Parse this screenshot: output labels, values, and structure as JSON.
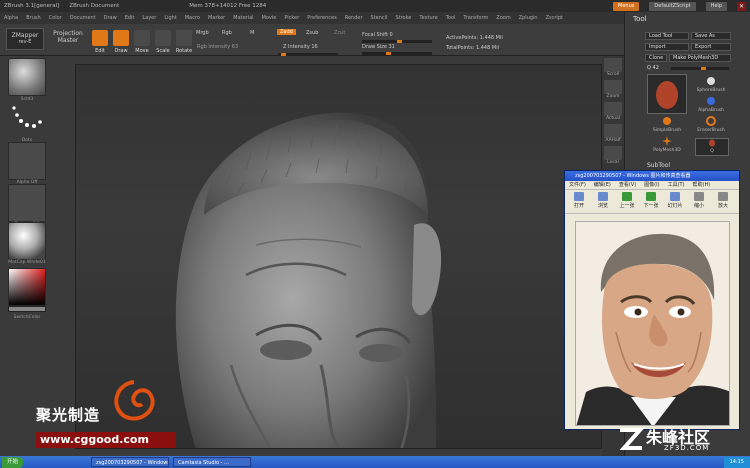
{
  "titlebar": {
    "app": "ZBrush 3.1[general]",
    "doc": "ZBrush Document",
    "mem": "Mem 378+14012 Free 1284",
    "menus_btn": "Menus",
    "script_btn": "DefaultZScript",
    "help_btn": "Help"
  },
  "menubar": {
    "items": [
      "Alpha",
      "Brush",
      "Color",
      "Document",
      "Draw",
      "Edit",
      "Layer",
      "Light",
      "Macro",
      "Marker",
      "Material",
      "Movie",
      "Picker",
      "Preferences",
      "Render",
      "Stencil",
      "Stroke",
      "Texture",
      "Tool",
      "Transform",
      "Zoom",
      "Zplugin",
      "Zscript"
    ]
  },
  "toolbar": {
    "zmapper": "ZMapper",
    "zmapper_sub": "rev-E",
    "projection": "Projection",
    "projection_sub": "Master",
    "edit": "Edit",
    "draw": "Draw",
    "move": "Move",
    "scale": "Scale",
    "rotate": "Rotate",
    "mrgb": "Mrgb",
    "rgb": "Rgb",
    "m": "M",
    "zadd": "Zadd",
    "zsub": "Zsub",
    "zcut": "Zcut",
    "rgb_intensity": "Rgb Intensity 63",
    "z_intensity": "Z Intensity 16",
    "focal_shift": "Focal Shift 0",
    "draw_size": "Draw Size 31",
    "active_points": "ActivePoints: 1.448 Mil",
    "total_points": "TotalPoints: 1.448 Mil"
  },
  "leftpanel": {
    "labels": [
      "Sstd3",
      "Dots",
      "Alpha Off",
      "Texture Off",
      "MatCap White01",
      "SwitchColor"
    ]
  },
  "shelf": {
    "labels": [
      "Scroll",
      "Zoom",
      "Actual",
      "AAHalf",
      "Local",
      "Frame",
      "Move",
      "Scale",
      "Rotate",
      "Polyf",
      "Transp",
      "Ghost"
    ]
  },
  "toolpanel": {
    "title": "Tool",
    "load": "Load Tool",
    "save": "Save As",
    "import": "Import",
    "export": "Export",
    "clone": "Clone",
    "make_poly": "Make PolyMesh3D",
    "q_value": "Q 42",
    "thumbs": [
      "SphereBrush",
      "AlphaBrush",
      "SimpleBrush",
      "EraserBrush",
      "PolyMesh3D",
      "Q"
    ],
    "subtool": "SubTool"
  },
  "viewer": {
    "title": "zsg200703290507 - Windows 图片和传真查看器",
    "menu": [
      "文件(F)",
      "编辑(E)",
      "查看(V)",
      "图像(I)",
      "工具(T)",
      "帮助(H)"
    ],
    "tools": [
      "打开",
      "浏览",
      "上一张",
      "下一张",
      "幻灯片",
      "缩小",
      "放大"
    ]
  },
  "taskbar": {
    "start": "开始",
    "tasks": [
      "zsg200703290507 - Windows...",
      "Camtasia Studio - ..."
    ],
    "time": "14:15"
  },
  "watermarks": {
    "cg_cn": "聚光制造",
    "cg_url": "www.cggood.com",
    "z3d_cn": "朱峰社区",
    "z3d_en": "ZF3D.COM"
  },
  "colors": {
    "accent": "#e07818",
    "panel": "#3b3b3b",
    "canvas": "#333333",
    "taskbar": "#2459c4"
  }
}
